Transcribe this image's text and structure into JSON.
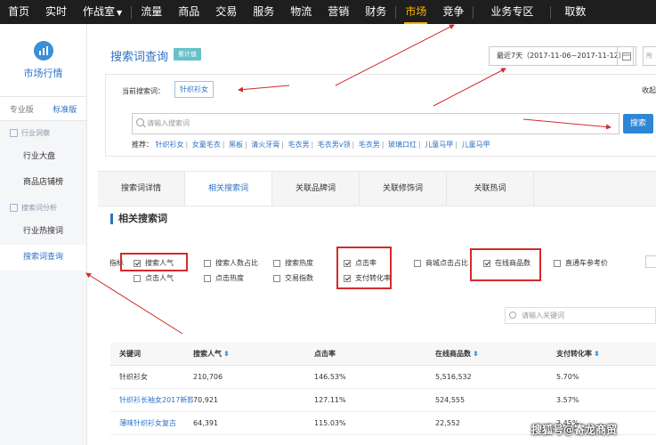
{
  "nav": {
    "items": [
      "首页",
      "实时",
      "作战室",
      "流量",
      "商品",
      "交易",
      "服务",
      "物流",
      "营销",
      "财务",
      "市场",
      "竞争",
      "业务专区",
      "取数"
    ]
  },
  "sidebar": {
    "title": "市场行情",
    "tabs": [
      "专业版",
      "标准版"
    ],
    "group1": "行业洞察",
    "item1": "行业大盘",
    "item2": "商品店铺榜",
    "group2": "搜索词分析",
    "item3": "行业热搜词",
    "item4": "搜索词查询"
  },
  "header": {
    "title": "搜索词查询",
    "badge": "累计值",
    "date_range": "最近7天（2017-11-06~2017-11-12）",
    "cut_label": "所"
  },
  "query": {
    "current_label": "当前搜索词：",
    "current_value": "针织衫女",
    "collect": "收起",
    "placeholder": "请输入搜索词",
    "search_btn": "搜索",
    "rec_label": "推荐：",
    "recommendations": [
      "针织衫女",
      "女童毛衣",
      "黑板",
      "清火牙膏",
      "毛衣男",
      "毛衣男v领",
      "毛衣男",
      "玻璃口红",
      "儿童马甲",
      "儿童马甲"
    ]
  },
  "tabs": [
    "搜索词详情",
    "相关搜索词",
    "关联品牌词",
    "关联修饰词",
    "关联热词"
  ],
  "section": {
    "title": "相关搜索词",
    "metric_label": "指标",
    "metrics": {
      "m1": "搜索人气",
      "m2": "搜索人数占比",
      "m3": "搜索热度",
      "m4": "点击率",
      "m5": "商城点击占比",
      "m6": "在线商品数",
      "m7": "直通车参考价",
      "m8": "点击人气",
      "m9": "点击热度",
      "m10": "交易指数",
      "m11": "支付转化率"
    },
    "kw_placeholder": "请输入关键词"
  },
  "table": {
    "headers": [
      "关键词",
      "搜索人气",
      "点击率",
      "在线商品数",
      "支付转化率"
    ],
    "sort_glyph": "⬍",
    "rows": [
      [
        "针织衫女",
        "210,706",
        "146.53%",
        "5,516,532",
        "5.70%"
      ],
      [
        "针织衫长袖女2017新款...",
        "70,921",
        "127.11%",
        "524,555",
        "3.57%"
      ],
      [
        "薄味针织衫女复古",
        "64,391",
        "115.03%",
        "22,552",
        "2.45%"
      ]
    ]
  },
  "watermark": "搜狐号@寄龙商贸"
}
